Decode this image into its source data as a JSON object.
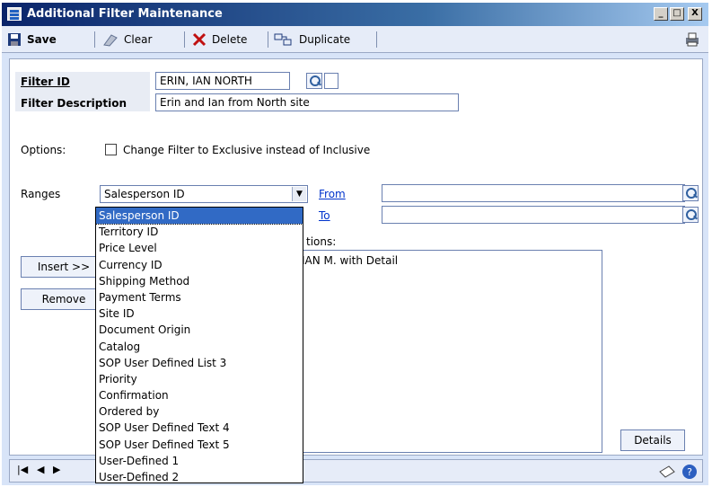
{
  "window": {
    "title": "Additional Filter Maintenance",
    "controls": {
      "minimize": "_",
      "maximize": "□",
      "close": "X"
    }
  },
  "toolbar": {
    "save_label": "Save",
    "clear_label": "Clear",
    "delete_label": "Delete",
    "duplicate_label": "Duplicate"
  },
  "form": {
    "filter_id_label": "Filter ID",
    "filter_id_value": "ERIN, IAN NORTH",
    "filter_description_label": "Filter Description",
    "filter_description_value": "Erin and Ian from North site",
    "options_label": "Options:",
    "exclusive_checkbox_label": "Change Filter to Exclusive instead of Inclusive",
    "exclusive_checked": false,
    "ranges_label": "Ranges",
    "ranges_selected": "Salesperson ID",
    "from_label": "From",
    "to_label": "To",
    "from_value": "",
    "to_value": "",
    "restrictions_label_fragment": "tions:",
    "restrictions_items": [
      "IAN M. with Detail"
    ],
    "insert_button": "Insert >>",
    "remove_button": "Remove",
    "details_button": "Details"
  },
  "ranges_dropdown": {
    "options": [
      "Salesperson ID",
      "Territory ID",
      "Price Level",
      "Currency ID",
      "Shipping Method",
      "Payment Terms",
      "Site ID",
      "Document Origin",
      "Catalog",
      "SOP User Defined List 3",
      "Priority",
      "Confirmation",
      "Ordered by",
      "SOP User Defined Text 4",
      "SOP User Defined Text 5",
      "User-Defined 1",
      "User-Defined 2"
    ],
    "selected_index": 0
  },
  "colors": {
    "accent": "#316ac5",
    "link": "#0033cc",
    "titlebar": "#0a246a"
  }
}
